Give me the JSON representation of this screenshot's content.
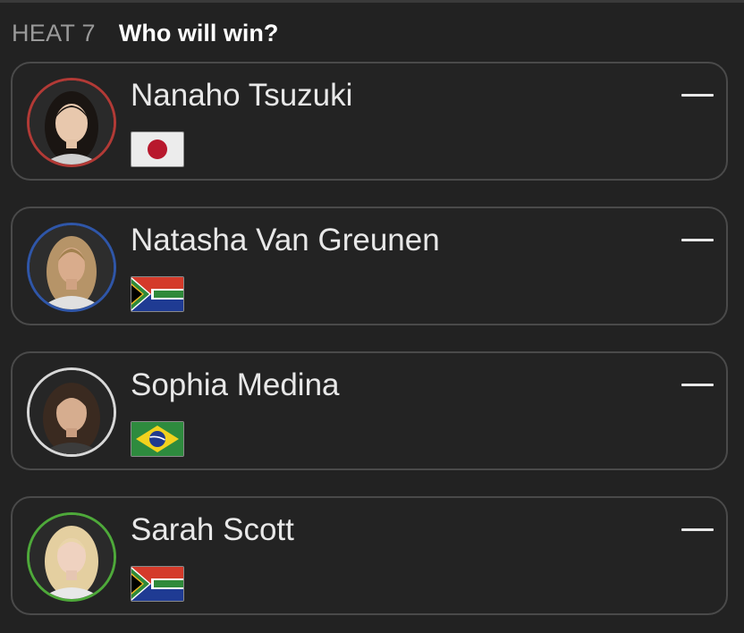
{
  "header": {
    "heat_label": "HEAT 7",
    "question": "Who will win?"
  },
  "surfers": [
    {
      "name": "Nanaho Tsuzuki",
      "ring_color": "#b23a36",
      "flag": "japan-flag",
      "pick_icon": "minus-icon"
    },
    {
      "name": "Natasha Van Greunen",
      "ring_color": "#2f56a8",
      "flag": "south-africa-flag",
      "pick_icon": "minus-icon"
    },
    {
      "name": "Sophia Medina",
      "ring_color": "#d8d8d8",
      "flag": "brazil-flag",
      "pick_icon": "minus-icon"
    },
    {
      "name": "Sarah Scott",
      "ring_color": "#4ea93a",
      "flag": "south-africa-flag",
      "pick_icon": "minus-icon"
    }
  ]
}
